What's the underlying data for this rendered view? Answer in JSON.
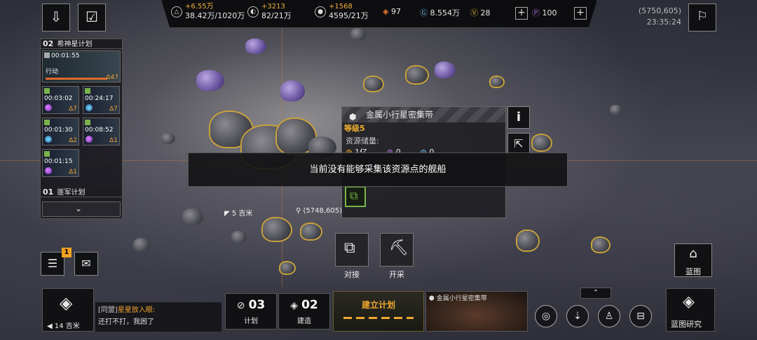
{
  "top_left_buttons": {
    "logout_icon": "exit-icon",
    "task_icon": "checklist-icon"
  },
  "resources": [
    {
      "delta": "+6.55万",
      "value": "38.42万/1020万",
      "icon": "metal"
    },
    {
      "delta": "+3213",
      "value": "82/21万",
      "icon": "crystal"
    },
    {
      "delta": "+1568",
      "value": "4595/21万",
      "icon": "deuterium"
    }
  ],
  "currencies": {
    "energy": "97",
    "credits": "8.554万",
    "gold": "28",
    "premium": "100"
  },
  "coords_top": "(5750,605)",
  "clock": "23:35:24",
  "plan_panel": {
    "group1_num": "02",
    "group1_title": "希神星计划",
    "main_task_timer": "00:01:55",
    "main_task_status": "行动",
    "main_task_tier": "Δ47",
    "tasks": [
      {
        "timer": "00:03:02",
        "tier": "Δ7"
      },
      {
        "timer": "00:24:17",
        "tier": "Δ7"
      },
      {
        "timer": "00:01:30",
        "tier": "Δ2"
      },
      {
        "timer": "00:08:52",
        "tier": "Δ1"
      },
      {
        "timer": "00:01:15",
        "tier": "Δ1"
      }
    ],
    "group2_num": "01",
    "group2_title": "匪军计划"
  },
  "info_panel": {
    "title": "金属小行星密集带",
    "level": "等级5",
    "reserve_label": "资源储量:",
    "reserve_value": "1亿",
    "reserve_b": "0",
    "reserve_c": "0"
  },
  "toast": "当前没有能够采集该资源点的舰船",
  "map_labels": {
    "distance": "5 吉米",
    "coords": "(5748,605)"
  },
  "actions": {
    "dock": "对接",
    "mine": "开采"
  },
  "blueprint": "蓝图",
  "mail_badge": "1",
  "bottom": {
    "distance": "14 吉米",
    "chat_channel": "[同盟]",
    "chat_user": "星星放入眼:",
    "chat_msg": "还打不打，我困了",
    "plan_count": "03",
    "plan_label": "计划",
    "build_count": "02",
    "build_label": "建造",
    "build_plan": "建立计划",
    "preview_title": "金属小行星密集带",
    "research": "蓝图研究"
  }
}
